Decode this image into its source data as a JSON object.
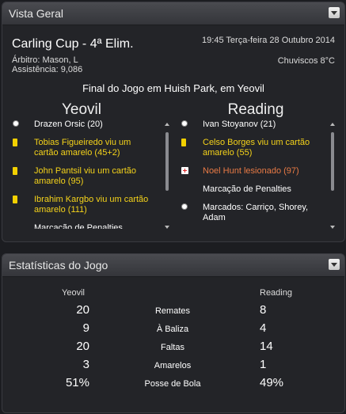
{
  "overview": {
    "title": "Vista Geral",
    "competition": "Carling Cup - 4ª Elim.",
    "referee": "Árbitro: Mason, L",
    "attendance": "Assistência: 9,086",
    "datetime": "19:45 Terça-feira 28 Outubro 2014",
    "weather": "Chuviscos 8°C",
    "result": "Final do Jogo em Huish Park, em Yeovil",
    "home": {
      "name": "Yeovil",
      "events": [
        {
          "icon": "ball-icon",
          "text": "Drazen Orsic (20)",
          "kind": "normal"
        },
        {
          "icon": "yellow-card-icon",
          "text": "Tobias Figueiredo viu um cartão amarelo (45+2)",
          "kind": "yellow"
        },
        {
          "icon": "yellow-card-icon",
          "text": "John Pantsil viu um cartão amarelo (95)",
          "kind": "yellow"
        },
        {
          "icon": "yellow-card-icon",
          "text": "Ibrahim Kargbo viu um cartão amarelo (111)",
          "kind": "yellow"
        },
        {
          "icon": "",
          "text": "Marcacão de Penalties",
          "kind": "normal"
        }
      ]
    },
    "away": {
      "name": "Reading",
      "events": [
        {
          "icon": "ball-icon",
          "text": "Ivan Stoyanov (21)",
          "kind": "normal"
        },
        {
          "icon": "yellow-card-icon",
          "text": "Celso Borges viu um cartão amarelo (55)",
          "kind": "yellow"
        },
        {
          "icon": "injury-icon",
          "text": "Noel Hunt lesionado (97)",
          "kind": "injury"
        },
        {
          "icon": "",
          "text": "Marcação de Penalties",
          "kind": "normal"
        },
        {
          "icon": "ball-icon",
          "text": "Marcados: Carriço, Shorey, Adam",
          "kind": "normal"
        }
      ]
    }
  },
  "stats": {
    "title": "Estatísticas do Jogo",
    "home_label": "Yeovil",
    "away_label": "Reading",
    "rows": [
      {
        "label": "Remates",
        "home": "20",
        "away": "8"
      },
      {
        "label": "À Baliza",
        "home": "9",
        "away": "4"
      },
      {
        "label": "Faltas",
        "home": "20",
        "away": "14"
      },
      {
        "label": "Amarelos",
        "home": "3",
        "away": "1"
      },
      {
        "label": "Posse de Bola",
        "home": "51%",
        "away": "49%"
      }
    ]
  }
}
